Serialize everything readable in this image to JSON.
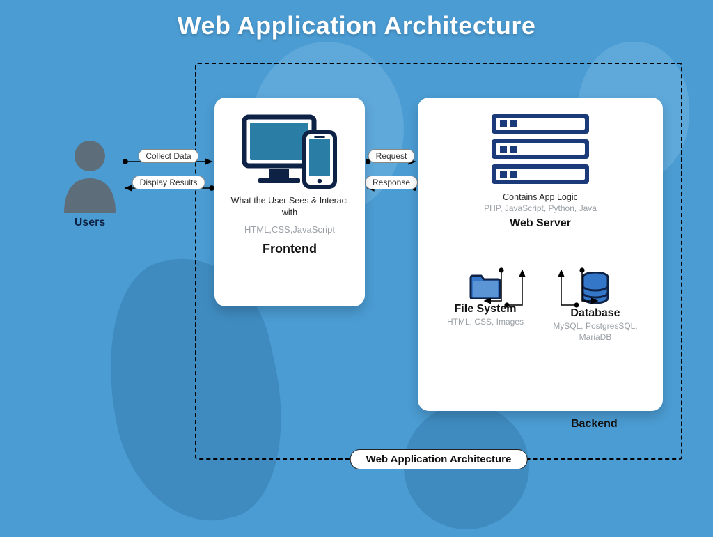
{
  "title": "Web Application Architecture",
  "frame_label": "Web Application Architecture",
  "users_label": "Users",
  "arrows_left": {
    "top": "Collect Data",
    "bottom": "Display Results"
  },
  "arrows_mid": {
    "top": "Request",
    "bottom": "Response"
  },
  "frontend": {
    "caption": "What the User Sees & Interact with",
    "tech": "HTML,CSS,JavaScript",
    "title": "Frontend"
  },
  "backend": {
    "caption": "Contains App Logic",
    "tech": "PHP, JavaScript, Python, Java",
    "web_server": "Web Server",
    "filesystem": {
      "title": "File System",
      "tech": "HTML, CSS, Images"
    },
    "database": {
      "title": "Database",
      "tech": "MySQL, PostgresSQL, MariaDB"
    },
    "label": "Backend"
  }
}
